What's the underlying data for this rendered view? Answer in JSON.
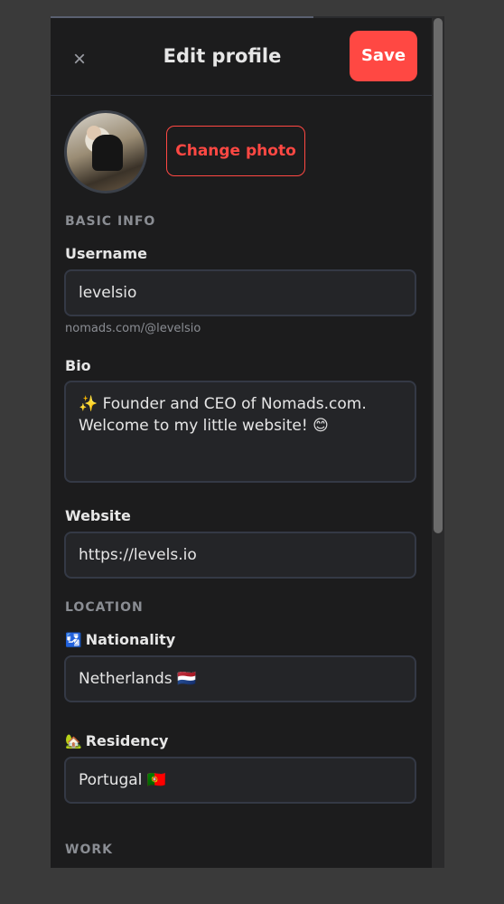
{
  "header": {
    "close_icon": "×",
    "title": "Edit profile",
    "save_label": "Save"
  },
  "photo": {
    "change_label": "Change photo"
  },
  "basic_info": {
    "heading": "BASIC INFO",
    "username": {
      "label": "Username",
      "value": "levelsio",
      "hint": "nomads.com/@levelsio"
    },
    "bio": {
      "label": "Bio",
      "value": "✨ Founder and CEO of Nomads.com. Welcome to my little website! 😊"
    },
    "website": {
      "label": "Website",
      "value": "https://levels.io"
    }
  },
  "location": {
    "heading": "LOCATION",
    "nationality": {
      "icon": "🛂",
      "label": "Nationality",
      "value": "Netherlands 🇳🇱"
    },
    "residency": {
      "icon": "🏡",
      "label": "Residency",
      "value": "Portugal 🇵🇹"
    }
  },
  "work": {
    "heading": "WORK"
  },
  "scroll": {
    "progress_fraction": 0.69
  },
  "colors": {
    "accent": "#ff4843",
    "background": "#1c1c1d",
    "field": "#242528"
  }
}
